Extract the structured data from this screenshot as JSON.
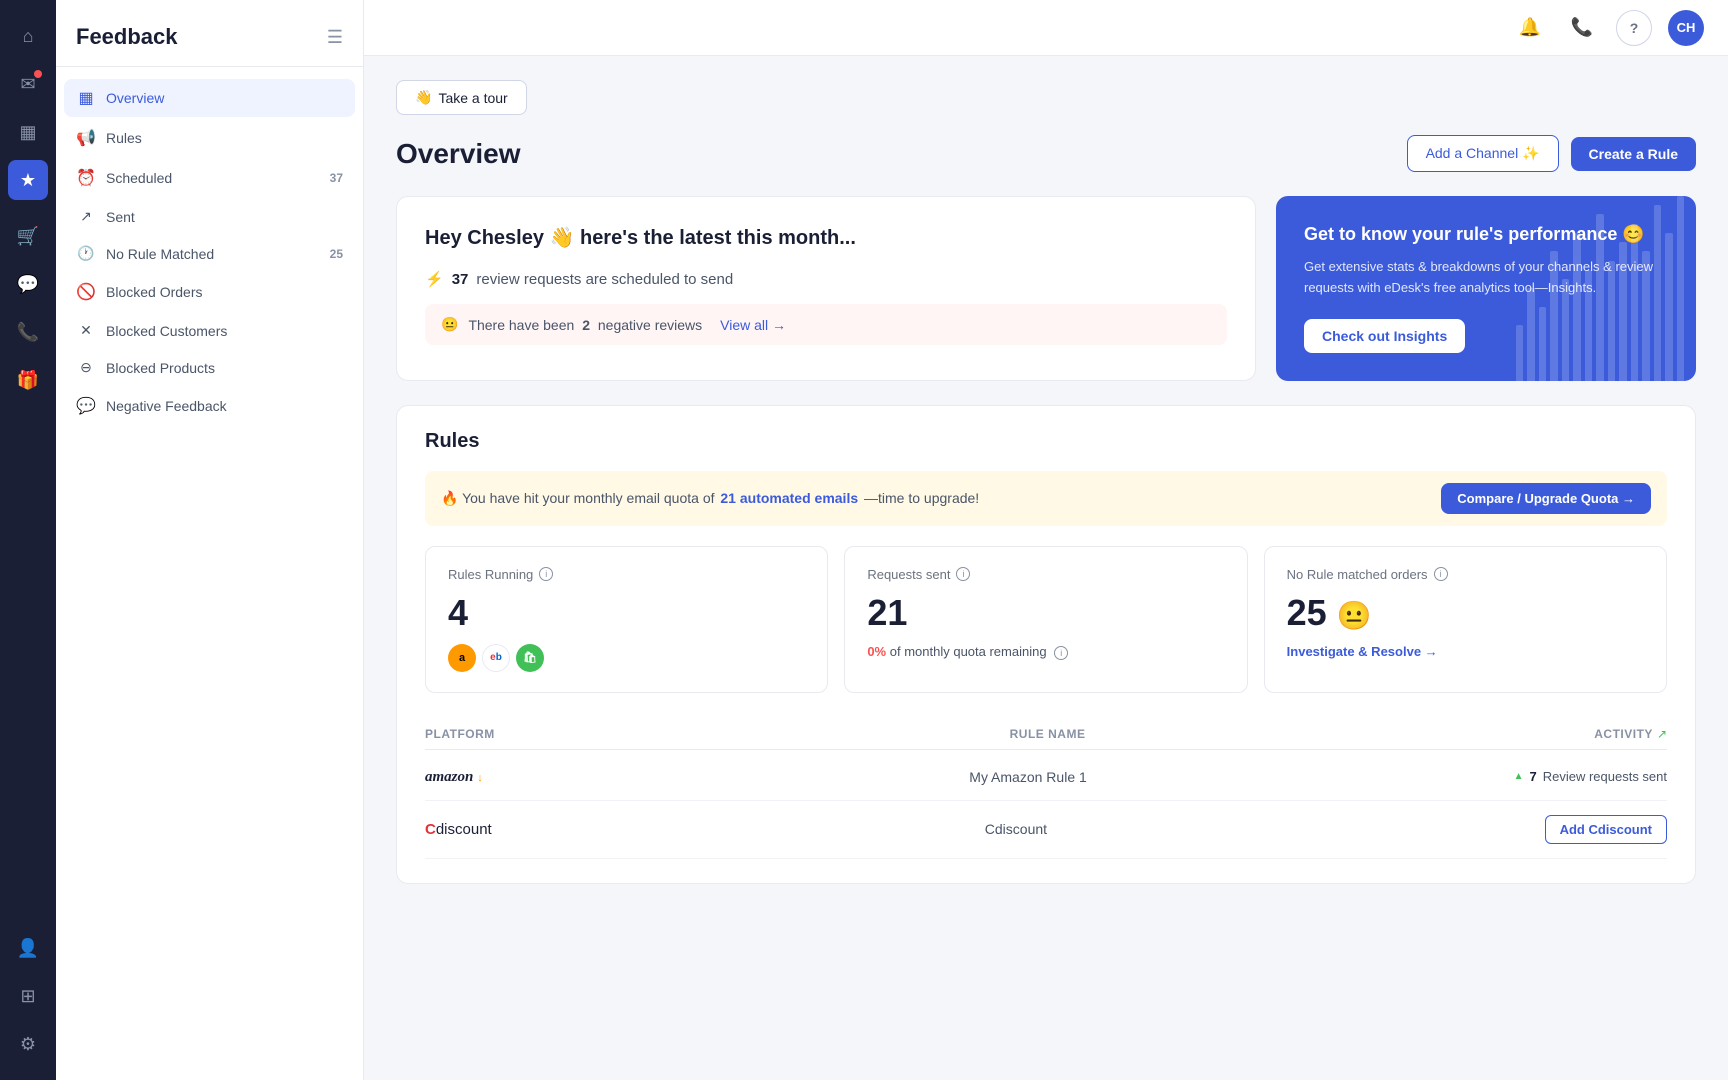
{
  "iconNav": {
    "items": [
      {
        "id": "home",
        "icon": "⌂",
        "active": false
      },
      {
        "id": "inbox",
        "icon": "✉",
        "active": false,
        "hasNotif": true
      },
      {
        "id": "chart",
        "icon": "▦",
        "active": false
      },
      {
        "id": "star",
        "icon": "★",
        "active": true
      },
      {
        "id": "cart",
        "icon": "⊞",
        "active": false
      },
      {
        "id": "chat",
        "icon": "💬",
        "active": false
      },
      {
        "id": "phone",
        "icon": "📞",
        "active": false
      },
      {
        "id": "gift",
        "icon": "🎁",
        "active": false
      },
      {
        "id": "users",
        "icon": "👤",
        "active": false
      },
      {
        "id": "apps",
        "icon": "⊞",
        "active": false
      },
      {
        "id": "settings",
        "icon": "⚙",
        "active": false
      }
    ]
  },
  "sidebar": {
    "title": "Feedback",
    "navItems": [
      {
        "id": "overview",
        "label": "Overview",
        "icon": "▦",
        "active": true,
        "badge": ""
      },
      {
        "id": "rules",
        "label": "Rules",
        "icon": "📢",
        "active": false,
        "badge": ""
      },
      {
        "id": "scheduled",
        "label": "Scheduled",
        "icon": "⏰",
        "active": false,
        "badge": "37"
      },
      {
        "id": "sent",
        "label": "Sent",
        "icon": "↗",
        "active": false,
        "badge": ""
      },
      {
        "id": "no-rule-matched",
        "label": "No Rule Matched",
        "icon": "🕐",
        "active": false,
        "badge": "25"
      },
      {
        "id": "blocked-orders",
        "label": "Blocked Orders",
        "icon": "🚫",
        "active": false,
        "badge": ""
      },
      {
        "id": "blocked-customers",
        "label": "Blocked Customers",
        "icon": "✕",
        "active": false,
        "badge": ""
      },
      {
        "id": "blocked-products",
        "label": "Blocked Products",
        "icon": "⊖",
        "active": false,
        "badge": ""
      },
      {
        "id": "negative-feedback",
        "label": "Negative Feedback",
        "icon": "💬",
        "active": false,
        "badge": ""
      }
    ]
  },
  "topHeader": {
    "bellIcon": "🔔",
    "phoneIcon": "📞",
    "helpIcon": "?",
    "avatar": "CH"
  },
  "tourButton": {
    "emoji": "👋",
    "label": "Take a tour"
  },
  "pageTitle": "Overview",
  "headerActions": {
    "addChannel": "Add a Channel ✨",
    "createRule": "Create a Rule"
  },
  "heyCard": {
    "title": "Hey Chesley 👋 here's the latest this month...",
    "statEmoji": "⚡",
    "statCount": "37",
    "statText": "review requests are scheduled to send",
    "negativeEmoji": "😐",
    "negativeText": "There have been",
    "negativeCount": "2",
    "negativeText2": "negative reviews",
    "viewAllLabel": "View all →"
  },
  "insightsCard": {
    "title": "Get to know your rule's performance 😊",
    "description": "Get extensive stats & breakdowns of your channels & review requests with eDesk's free analytics tool—Insights.",
    "buttonLabel": "Check out Insights",
    "bars": [
      30,
      50,
      40,
      70,
      55,
      80,
      60,
      90,
      65,
      75,
      85,
      70,
      95,
      80,
      100
    ]
  },
  "rulesSection": {
    "title": "Rules",
    "quotaAlert": {
      "emoji": "🔥",
      "text": "You have hit your monthly email quota of",
      "count": "21 automated emails",
      "suffix": "—time to upgrade!",
      "buttonLabel": "Compare / Upgrade Quota →"
    },
    "stats": [
      {
        "id": "rules-running",
        "label": "Rules Running",
        "value": "4",
        "platforms": [
          "amazon",
          "ebay",
          "shopify"
        ]
      },
      {
        "id": "requests-sent",
        "label": "Requests sent",
        "value": "21",
        "quotaText": "0% of monthly quota remaining",
        "quotaZero": "0%"
      },
      {
        "id": "no-rule-matched-orders",
        "label": "No Rule matched orders",
        "value": "25",
        "emoji": "😐",
        "linkLabel": "Investigate & Resolve →"
      }
    ],
    "tableHeaders": {
      "platform": "Platform",
      "ruleName": "Rule name",
      "activity": "Activity"
    },
    "tableRows": [
      {
        "id": "amazon-row",
        "platform": "amazon",
        "platformLabel": "amazon",
        "ruleName": "My Amazon Rule 1",
        "activityCount": "7",
        "activityDesc": "Review requests sent",
        "actionLabel": ""
      },
      {
        "id": "cdiscount-row",
        "platform": "cdiscount",
        "platformLabel": "Cdiscount",
        "ruleName": "Cdiscount",
        "activityCount": "",
        "activityDesc": "",
        "actionLabel": "Add Cdiscount"
      }
    ]
  }
}
